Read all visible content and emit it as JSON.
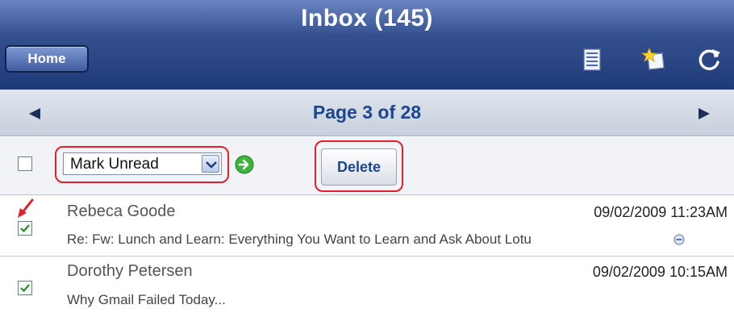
{
  "header": {
    "title": "Inbox (145)",
    "home_label": "Home",
    "icons": [
      "list-icon",
      "new-message-icon",
      "refresh-icon"
    ]
  },
  "pager": {
    "text": "Page 3 of 28"
  },
  "toolbar": {
    "action_select": {
      "value": "Mark Unread"
    },
    "delete_label": "Delete"
  },
  "messages": [
    {
      "sender": "Rebeca Goode",
      "date": "09/02/2009 11:23AM",
      "subject": "Re: Fw: Lunch and Learn: Everything You Want to Learn and Ask About Lotu",
      "checked": true
    },
    {
      "sender": "Dorothy Petersen",
      "date": "09/02/2009 10:15AM",
      "subject": "Why Gmail Failed Today...",
      "checked": true
    }
  ],
  "colors": {
    "header_dark": "#1f3a78",
    "pager_text": "#1c4690",
    "highlight": "#e0202a"
  }
}
